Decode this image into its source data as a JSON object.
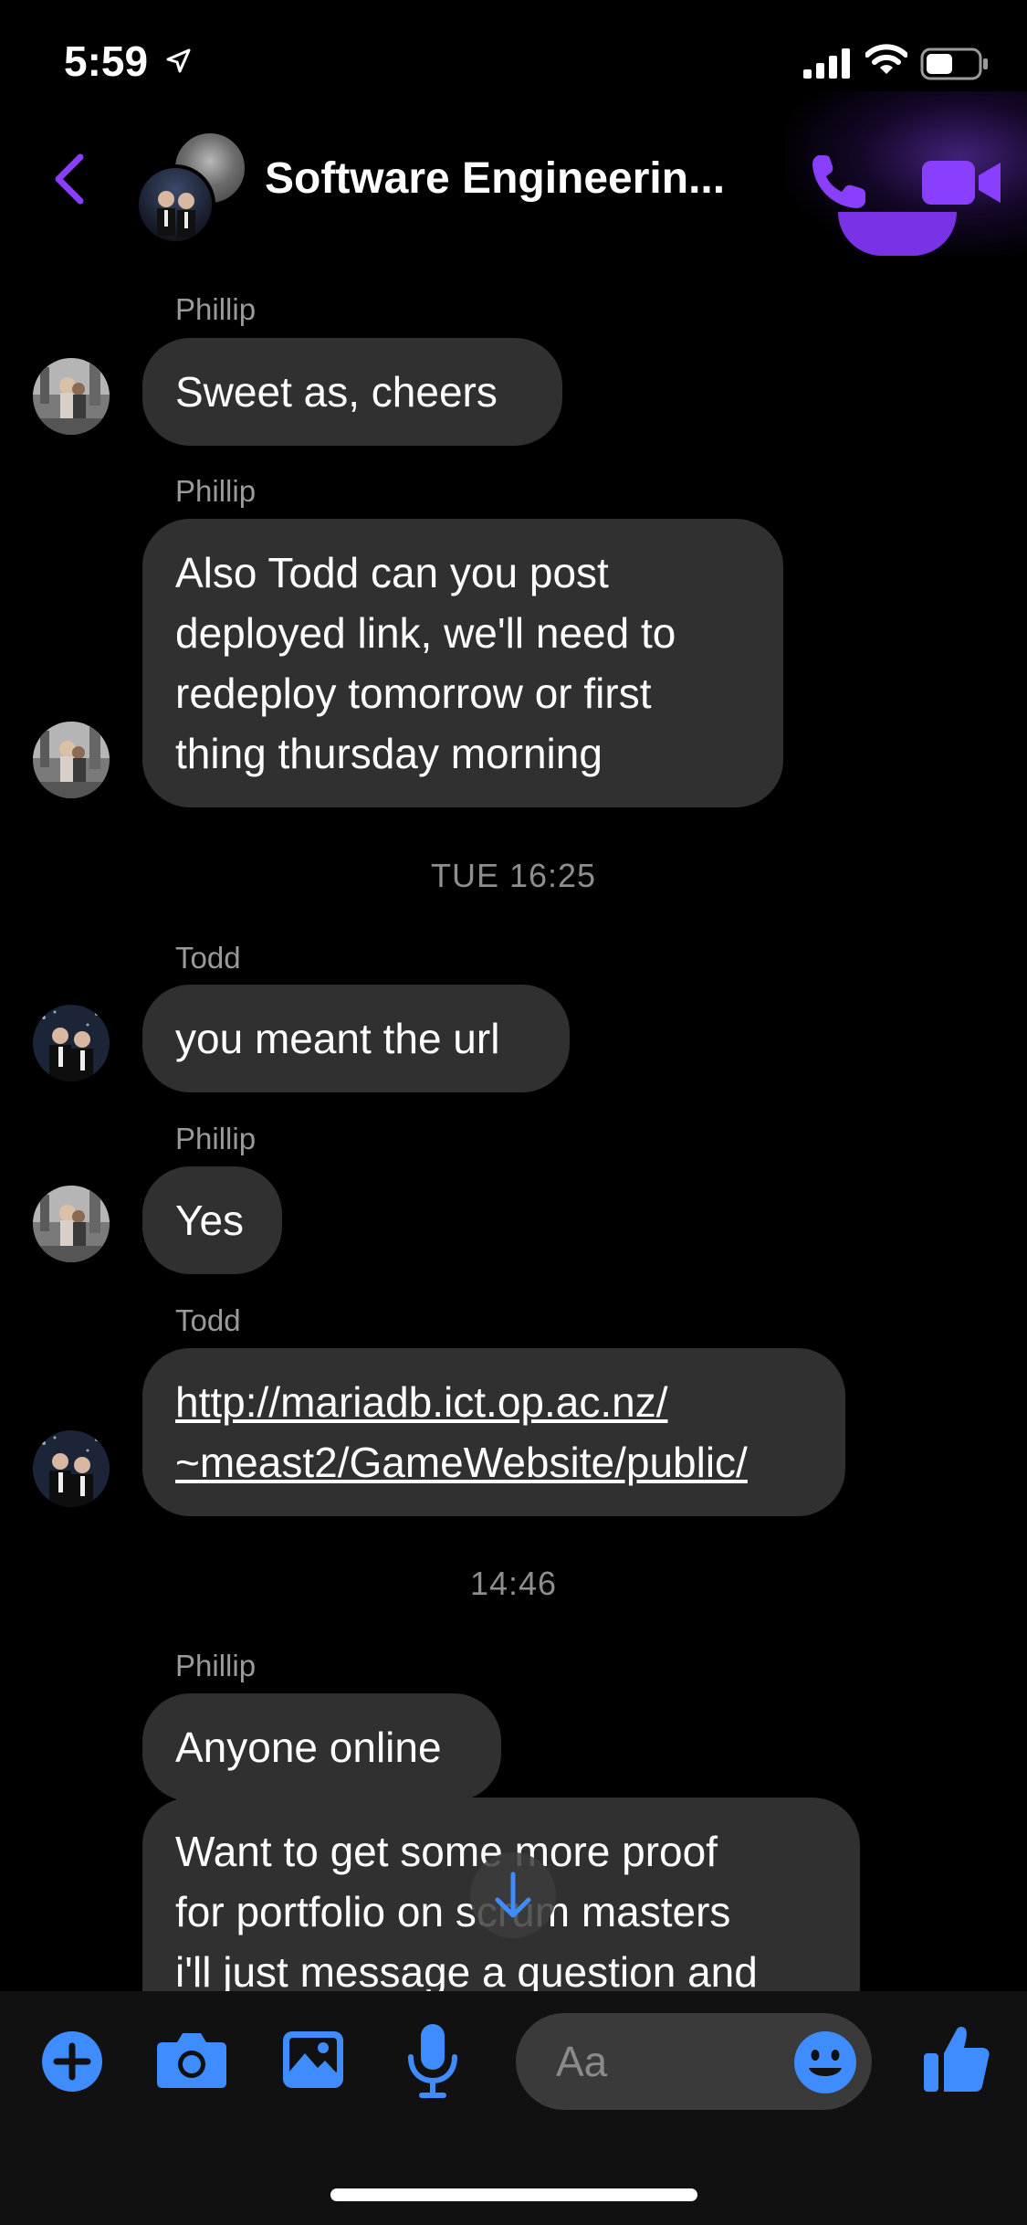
{
  "status_bar": {
    "time": "5:59"
  },
  "header": {
    "title": "Software Engineerin...",
    "accent_color": "#8a3ffc"
  },
  "messages": [
    {
      "sender": "Phillip",
      "lines": [
        "Sweet as, cheers"
      ]
    },
    {
      "sender": "Phillip",
      "lines": [
        "Also Todd can you post",
        "deployed link, we'll need to",
        "redeploy tomorrow or first",
        "thing thursday morning"
      ]
    },
    {
      "sender": "Todd",
      "lines": [
        "you meant the url"
      ]
    },
    {
      "sender": "Phillip",
      "lines": [
        "Yes"
      ]
    },
    {
      "sender": "Todd",
      "lines": [
        "http://mariadb.ict.op.ac.nz/",
        "~meast2/GameWebsite/public/"
      ]
    },
    {
      "sender": "Phillip",
      "lines": [
        "Anyone online"
      ]
    },
    {
      "sender": "",
      "lines": [
        "Want to get some more proof",
        "for portfolio on scrum masters",
        "i'll just message a question and"
      ]
    }
  ],
  "timestamps": [
    "TUE 16:25",
    "14:46"
  ],
  "composer": {
    "placeholder": "Aa",
    "icon_color": "#3f8cff"
  }
}
